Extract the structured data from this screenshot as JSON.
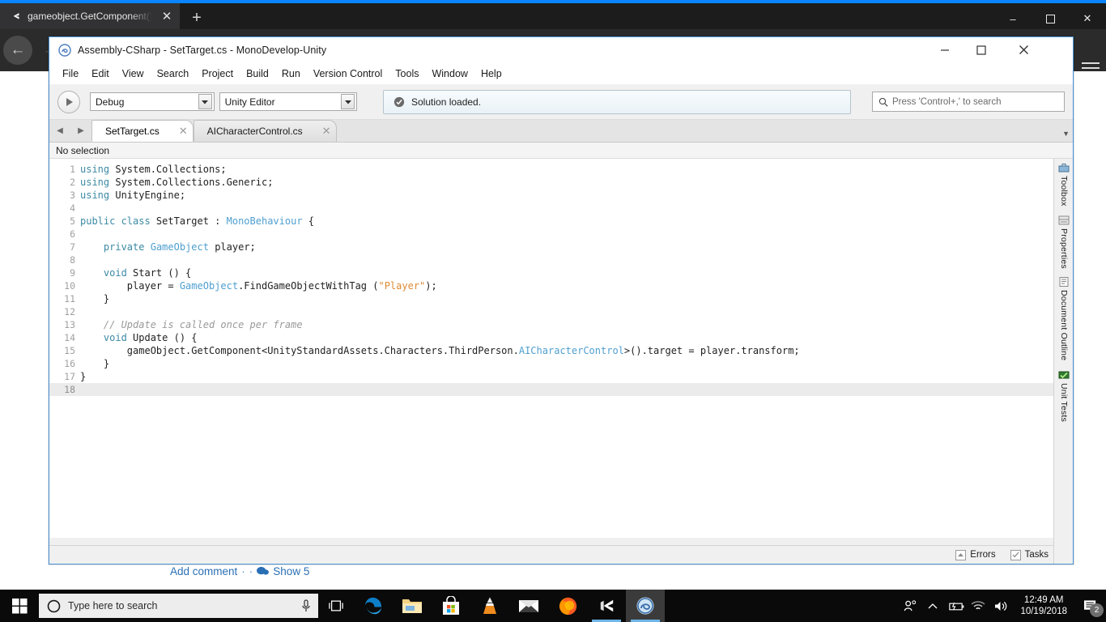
{
  "browser": {
    "tab": {
      "title": "gameobject.GetComponent().t",
      "favicon": "unity-icon",
      "close": "✕"
    },
    "new_tab": "+",
    "window_controls": {
      "minimize": "–",
      "maximize": "❐",
      "close": "✕"
    },
    "nav": {
      "back": "←",
      "forward": "→"
    },
    "page": {
      "add_comment": "Add comment",
      "separator": "·",
      "show_replies": "Show 5",
      "comment_icon": "comment-bubble-icon"
    }
  },
  "monodevelop": {
    "title": "Assembly-CSharp - SetTarget.cs - MonoDevelop-Unity",
    "title_icon": "monodevelop-icon",
    "window_controls": {
      "minimize": "—",
      "maximize": "☐",
      "close": "✕"
    },
    "menu": [
      "File",
      "Edit",
      "View",
      "Search",
      "Project",
      "Build",
      "Run",
      "Version Control",
      "Tools",
      "Window",
      "Help"
    ],
    "toolbar": {
      "run_icon": "play-icon",
      "configuration": {
        "value": "Debug",
        "arrow": "▼"
      },
      "runtime": {
        "value": "Unity Editor",
        "arrow": "▼"
      },
      "status_text": "Solution loaded.",
      "status_icon": "check-circle-icon",
      "search_placeholder": "Press 'Control+,' to search",
      "search_icon": "search-icon",
      "search_value": ""
    },
    "tabbar": {
      "prev": "◀",
      "next": "▶",
      "overflow": "▼",
      "tabs": [
        {
          "label": "SetTarget.cs",
          "close": "✕",
          "active": true
        },
        {
          "label": "AICharacterControl.cs",
          "close": "✕",
          "active": false
        }
      ]
    },
    "breadcrumb": "No selection",
    "editor": {
      "scroll_up": "▲",
      "scroll_down": "▼",
      "current_line": 18,
      "lines": [
        {
          "n": 1,
          "tokens": [
            {
              "c": "k",
              "t": "using"
            },
            {
              "c": "",
              "t": " System.Collections;"
            }
          ]
        },
        {
          "n": 2,
          "tokens": [
            {
              "c": "k",
              "t": "using"
            },
            {
              "c": "",
              "t": " System.Collections.Generic;"
            }
          ]
        },
        {
          "n": 3,
          "tokens": [
            {
              "c": "k",
              "t": "using"
            },
            {
              "c": "",
              "t": " UnityEngine;"
            }
          ]
        },
        {
          "n": 4,
          "tokens": []
        },
        {
          "n": 5,
          "tokens": [
            {
              "c": "k",
              "t": "public class"
            },
            {
              "c": "",
              "t": " SetTarget : "
            },
            {
              "c": "t",
              "t": "MonoBehaviour"
            },
            {
              "c": "",
              "t": " {"
            }
          ]
        },
        {
          "n": 6,
          "tokens": []
        },
        {
          "n": 7,
          "tokens": [
            {
              "c": "",
              "t": "    "
            },
            {
              "c": "k",
              "t": "private"
            },
            {
              "c": "",
              "t": " "
            },
            {
              "c": "t",
              "t": "GameObject"
            },
            {
              "c": "",
              "t": " player;"
            }
          ]
        },
        {
          "n": 8,
          "tokens": []
        },
        {
          "n": 9,
          "tokens": [
            {
              "c": "",
              "t": "    "
            },
            {
              "c": "k",
              "t": "void"
            },
            {
              "c": "",
              "t": " Start () {"
            }
          ]
        },
        {
          "n": 10,
          "tokens": [
            {
              "c": "",
              "t": "        player = "
            },
            {
              "c": "t",
              "t": "GameObject"
            },
            {
              "c": "",
              "t": ".FindGameObjectWithTag ("
            },
            {
              "c": "s",
              "t": "\"Player\""
            },
            {
              "c": "",
              "t": ");"
            }
          ]
        },
        {
          "n": 11,
          "tokens": [
            {
              "c": "",
              "t": "    }"
            }
          ]
        },
        {
          "n": 12,
          "tokens": []
        },
        {
          "n": 13,
          "tokens": [
            {
              "c": "",
              "t": "    "
            },
            {
              "c": "cm",
              "t": "// Update is called once per frame"
            }
          ]
        },
        {
          "n": 14,
          "tokens": [
            {
              "c": "",
              "t": "    "
            },
            {
              "c": "k",
              "t": "void"
            },
            {
              "c": "",
              "t": " Update () {"
            }
          ]
        },
        {
          "n": 15,
          "tokens": [
            {
              "c": "",
              "t": "        gameObject.GetComponent<UnityStandardAssets.Characters.ThirdPerson."
            },
            {
              "c": "t",
              "t": "AICharacterControl"
            },
            {
              "c": "",
              "t": ">().target = player.transform;"
            }
          ]
        },
        {
          "n": 16,
          "tokens": [
            {
              "c": "",
              "t": "    }"
            }
          ]
        },
        {
          "n": 17,
          "tokens": [
            {
              "c": "",
              "t": "}"
            }
          ]
        },
        {
          "n": 18,
          "tokens": []
        }
      ]
    },
    "pads": [
      {
        "label": "Toolbox",
        "icon": "toolbox-icon"
      },
      {
        "label": "Properties",
        "icon": "properties-icon"
      },
      {
        "label": "Document Outline",
        "icon": "document-outline-icon"
      },
      {
        "label": "Unit Tests",
        "icon": "unit-tests-icon"
      }
    ],
    "statusbar": {
      "errors": {
        "label": "Errors",
        "icon": "triangle-up-icon"
      },
      "tasks": {
        "label": "Tasks",
        "icon": "check-icon"
      }
    }
  },
  "taskbar": {
    "start": "windows-logo-icon",
    "search_placeholder": "Type here to search",
    "search_icon": "cortana-circle-icon",
    "mic_icon": "microphone-icon",
    "taskview_icon": "task-view-icon",
    "apps": [
      {
        "name": "edge-icon",
        "active": false,
        "running": false
      },
      {
        "name": "file-explorer-icon",
        "active": false,
        "running": false
      },
      {
        "name": "microsoft-store-icon",
        "active": false,
        "running": false
      },
      {
        "name": "vlc-icon",
        "active": false,
        "running": false
      },
      {
        "name": "mail-icon",
        "active": false,
        "running": false
      },
      {
        "name": "firefox-icon",
        "active": false,
        "running": true
      },
      {
        "name": "unity-icon",
        "active": false,
        "running": true
      },
      {
        "name": "monodevelop-icon",
        "active": true,
        "running": true
      }
    ],
    "tray": [
      {
        "name": "people-icon"
      },
      {
        "name": "show-hidden-icons-chevron"
      },
      {
        "name": "battery-icon"
      },
      {
        "name": "wifi-icon"
      },
      {
        "name": "volume-icon"
      }
    ],
    "clock": {
      "time": "12:49 AM",
      "date": "10/19/2018"
    },
    "notifications": {
      "icon": "action-center-icon",
      "count": "2"
    }
  },
  "colors": {
    "accent_blue": "#0a84ff",
    "window_border": "#4a94d8",
    "keyword": "#3c8aa4",
    "type": "#4f9fd0",
    "string": "#dd8a33",
    "comment": "#9a9a9a",
    "link": "#2a6fb5",
    "taskbar": "#0a0a0a"
  }
}
